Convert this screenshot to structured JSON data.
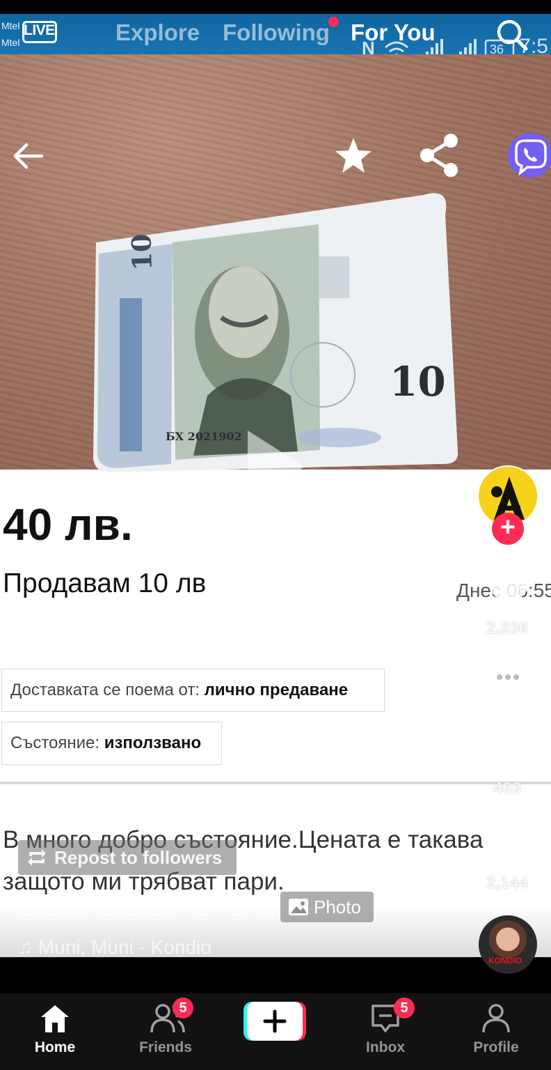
{
  "status_bar": {
    "carrier_1": "Mtel",
    "carrier_2": "Mtel",
    "clock": "7:5",
    "battery": "36",
    "icons": [
      "nfc-icon",
      "wifi-icon",
      "signal-icon",
      "signal-icon",
      "battery-icon"
    ]
  },
  "top_nav": {
    "live_label": "LIVE",
    "tabs": [
      "Explore",
      "Following",
      "For You"
    ],
    "active_tab": "For You",
    "following_has_notification": true,
    "icons": [
      "live-tv-icon",
      "search-icon"
    ]
  },
  "photo": {
    "image": "banknote-photo",
    "carousel_pages": 2,
    "icons": [
      "back-arrow-icon",
      "star-icon",
      "share-icon",
      "viber-icon",
      "play-icon"
    ]
  },
  "listing": {
    "price": "40 лв.",
    "title": "Продавам 10 лв",
    "date": "Днес 06:55",
    "delivery_label": "Доставката се поема от:",
    "delivery_value": "лично предаване",
    "condition_label": "Състояние:",
    "condition_value": "използвано",
    "description": "В много добро състояние.Цената е такава защото ми трябват пари."
  },
  "right_rail": {
    "likes": "2,236",
    "comments": "",
    "saves": "463",
    "shares": "2,144",
    "icons": [
      "creator-avatar",
      "follow-plus-icon",
      "heart-icon",
      "comment-icon",
      "bookmark-icon",
      "share-arrow-icon",
      "music-disc"
    ]
  },
  "post_overlay": {
    "repost_label": "Repost to followers",
    "caption": "i_ž_g_ó_ŋ_ε_ŋ ó_ť ľ_ă_q",
    "photo_chip_label": "Photo",
    "music": "Muni, Muni - Kondio",
    "music_disc_label": "KONDIO",
    "icons": [
      "repost-icon",
      "photo-icon",
      "music-note-icon"
    ]
  },
  "bottom_nav": {
    "items": [
      {
        "label": "Home",
        "icon": "home-icon",
        "active": true
      },
      {
        "label": "Friends",
        "icon": "friends-icon",
        "badge": "5"
      },
      {
        "label": "",
        "icon": "create-plus-icon"
      },
      {
        "label": "Inbox",
        "icon": "inbox-icon",
        "badge": "5"
      },
      {
        "label": "Profile",
        "icon": "profile-icon"
      }
    ]
  },
  "colors": {
    "status_bar": "#1874b2",
    "accent_red": "#fe2c55",
    "tab_bar": "#121212",
    "create_cyan": "#25f4ee",
    "creator_yellow": "#f7d21b"
  }
}
